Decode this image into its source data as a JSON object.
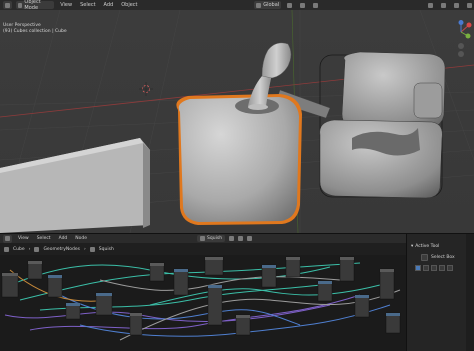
{
  "header": {
    "mode_label": "Object Mode",
    "menus": [
      "View",
      "Select",
      "Add",
      "Object"
    ],
    "orientation_label": "Global"
  },
  "viewport": {
    "perspective_label": "User Perspective",
    "collection_label": "(93) Cubes collection | Cube"
  },
  "node_editor": {
    "header_menus": [
      "View",
      "Select",
      "Add",
      "Node"
    ],
    "node_group_label": "Squish",
    "breadcrumb": [
      "Cube",
      "GeometryNodes",
      "Squish"
    ]
  },
  "side_panel": {
    "title": "Active Tool",
    "tool_label": "Select Box"
  },
  "colors": {
    "selection_orange": "#e0781e",
    "node_teal": "#3bbfa8",
    "node_purple": "#7e60c8",
    "node_blue": "#4f7fd0"
  }
}
